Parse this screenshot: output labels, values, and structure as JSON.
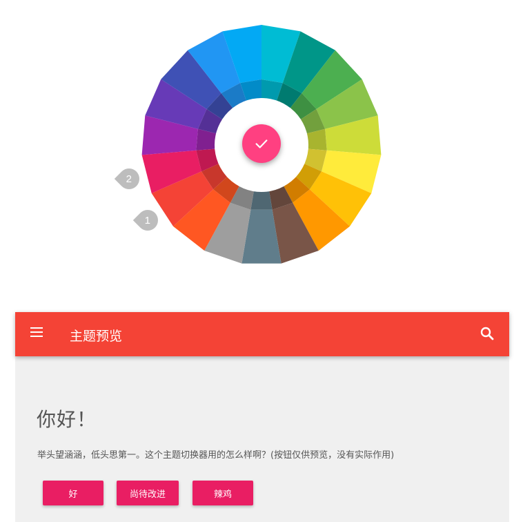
{
  "theme_wheel": {
    "selected_icon": "check-icon",
    "markers": [
      "1",
      "2"
    ],
    "colors": [
      "#00bcd4",
      "#009688",
      "#4caf50",
      "#8bc34a",
      "#cddc39",
      "#ffeb3b",
      "#ffc107",
      "#ff9800",
      "#795548",
      "#607d8b",
      "#9e9e9e",
      "#ff5722",
      "#f44336",
      "#e91e63",
      "#9c27b0",
      "#673ab7",
      "#3f51b5",
      "#2196f3",
      "#03a9f4"
    ],
    "accent": "#ff4081"
  },
  "preview": {
    "app_bar": {
      "title": "主题预览",
      "menu_icon": "menu-icon",
      "search_icon": "search-icon",
      "color": "#f44336"
    },
    "greeting": "你好！",
    "body": "举头望涵涵，低头思第一。这个主题切换器用的怎么样啊？(按钮仅供预览，没有实际作用)",
    "buttons": [
      "好",
      "尚待改进",
      "辣鸡"
    ],
    "button_color": "#e91e63"
  }
}
